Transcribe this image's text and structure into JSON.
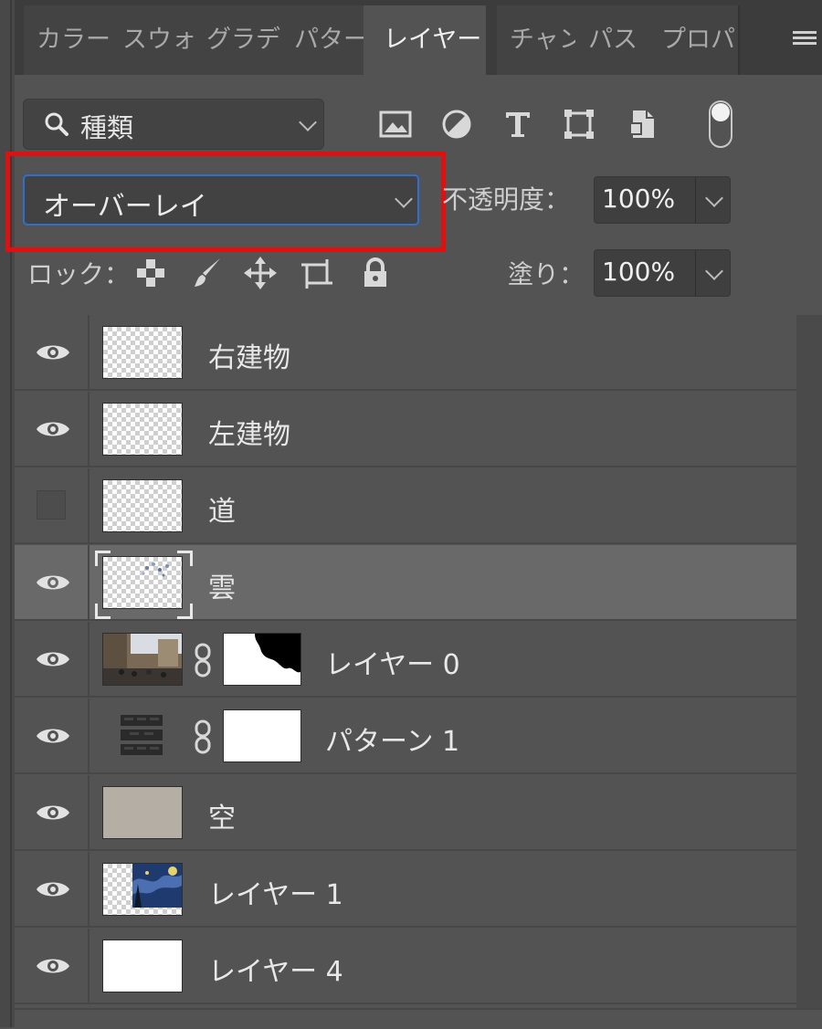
{
  "tabs": [
    {
      "label": "カラー",
      "active": false
    },
    {
      "label": "スウォ",
      "active": false
    },
    {
      "label": "グラデ",
      "active": false
    },
    {
      "label": "パター",
      "active": false
    },
    {
      "label": "レイヤー",
      "active": true
    },
    {
      "label": "チャン",
      "active": false
    },
    {
      "label": "パス",
      "active": false
    },
    {
      "label": "プロパ",
      "active": false
    }
  ],
  "filter": {
    "kind_label": "種類",
    "icons": [
      "image-filter-icon",
      "adjustment-filter-icon",
      "type-filter-icon",
      "shape-filter-icon",
      "smart-object-filter-icon"
    ]
  },
  "blend": {
    "mode": "オーバーレイ",
    "opacity_label": "不透明度：",
    "opacity_value": "100%"
  },
  "lock": {
    "label": "ロック：",
    "fill_label": "塗り：",
    "fill_value": "100%"
  },
  "layers": [
    {
      "name": "右建物",
      "visible": true,
      "thumb": "transparent"
    },
    {
      "name": "左建物",
      "visible": true,
      "thumb": "transparent"
    },
    {
      "name": "道",
      "visible": false,
      "thumb": "transparent"
    },
    {
      "name": "雲",
      "visible": true,
      "thumb": "transparent",
      "selected": true
    },
    {
      "name": "レイヤー 0",
      "visible": true,
      "thumb": "photo",
      "mask": true
    },
    {
      "name": "パターン 1",
      "visible": true,
      "thumb": "pattern",
      "mask": true
    },
    {
      "name": "空",
      "visible": true,
      "thumb": "solid"
    },
    {
      "name": "レイヤー 1",
      "visible": true,
      "thumb": "painting"
    },
    {
      "name": "レイヤー 4",
      "visible": true,
      "thumb": "white"
    }
  ],
  "colors": {
    "panel_bg": "#535353",
    "selected_row": "#696969",
    "highlight": "#e01010",
    "focus_border": "#2f6fd1",
    "sky_swatch": "#b4aea4"
  }
}
